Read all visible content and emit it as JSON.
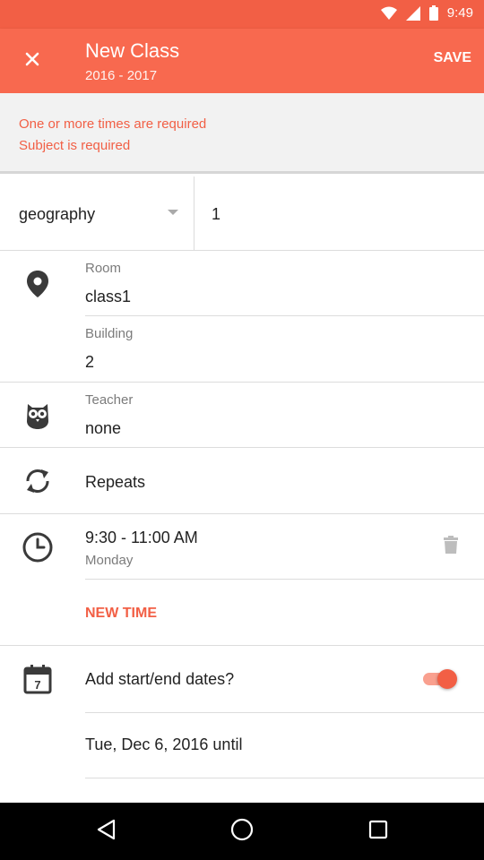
{
  "status_bar": {
    "time": "9:49"
  },
  "app_bar": {
    "close_icon": "close-icon",
    "title": "New Class",
    "subtitle": "2016 - 2017",
    "save_label": "SAVE"
  },
  "errors": {
    "lines": [
      "One or more times are required",
      "Subject is required"
    ]
  },
  "subject": {
    "value": "geography",
    "count": "1"
  },
  "room": {
    "label": "Room",
    "value": "class1"
  },
  "building": {
    "label": "Building",
    "value": "2"
  },
  "teacher": {
    "label": "Teacher",
    "value": "none"
  },
  "repeats": {
    "label": "Repeats"
  },
  "time_slot": {
    "time": "9:30 - 11:00 AM",
    "day": "Monday"
  },
  "new_time_label": "NEW TIME",
  "dates": {
    "label": "Add start/end dates?",
    "toggle_on": true,
    "start_text": "Tue, Dec 6, 2016 until"
  },
  "colors": {
    "accent": "#f25f45",
    "app_bar": "#f8694f",
    "error_bg": "#f2f2f2",
    "icon": "#3a3a3a"
  }
}
